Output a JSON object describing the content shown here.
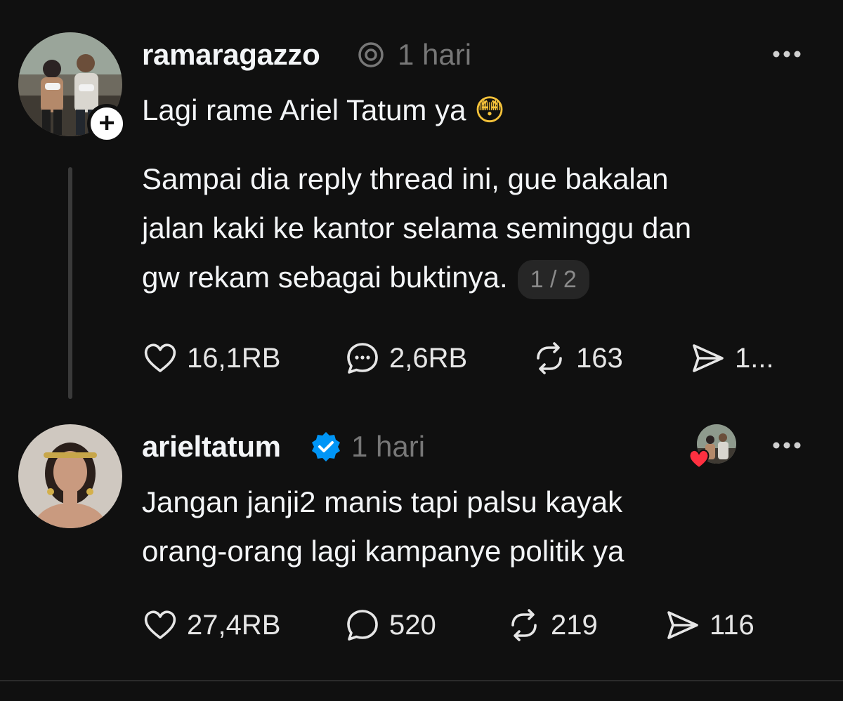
{
  "post1": {
    "username": "ramaragazzo",
    "time": "1 hari",
    "line1": "Lagi rame Ariel Tatum ya",
    "emoji": "😳",
    "body_lines": [
      "Sampai dia reply thread ini, gue bakalan",
      "jalan kaki ke kantor selama seminggu dan",
      "gw rekam sebagai buktinya."
    ],
    "pager": "1 / 2",
    "likes": "16,1RB",
    "replies": "2,6RB",
    "reposts": "163",
    "shares": "1..."
  },
  "post2": {
    "username": "arieltatum",
    "time": "1 hari",
    "body_lines": [
      "Jangan janji2 manis tapi palsu kayak",
      "orang-orang lagi kampanye politik ya"
    ],
    "likes": "27,4RB",
    "replies": "520",
    "reposts": "219",
    "shares": "116"
  },
  "icons": {
    "like": "heart-icon",
    "reply": "comment-icon",
    "repost": "repost-icon",
    "share": "send-icon",
    "more": "more-horizontal-icon",
    "verified": "verified-badge-icon",
    "threads": "threads-logo-icon"
  },
  "colors": {
    "background": "#101010",
    "text": "#f3f5f7",
    "muted": "#777777",
    "verified": "#0095f6",
    "heart": "#ff3040"
  }
}
